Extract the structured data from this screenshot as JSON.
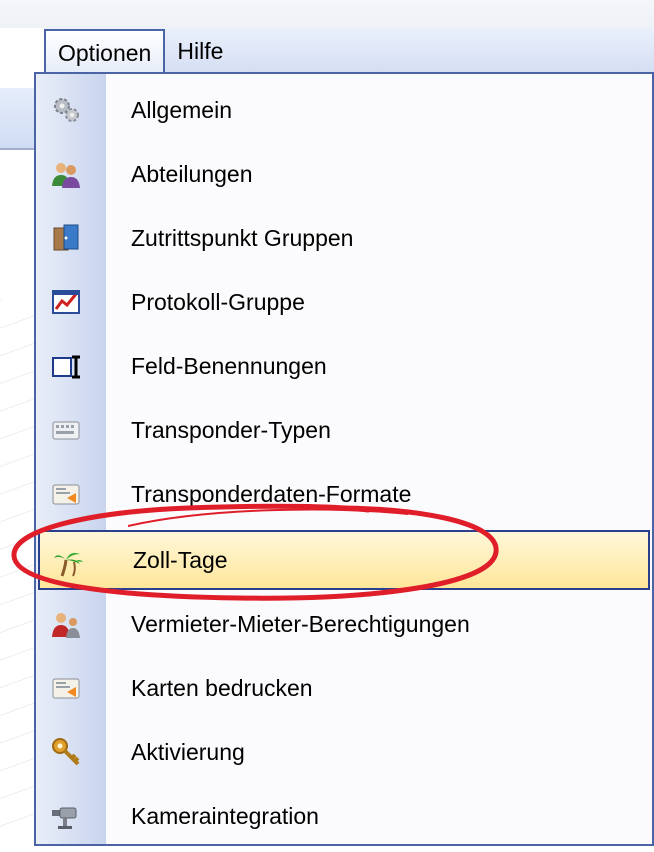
{
  "menubar": {
    "items": [
      {
        "label": "Optionen",
        "active": true
      },
      {
        "label": "Hilfe",
        "active": false
      }
    ]
  },
  "menu": {
    "items": [
      {
        "label": "Allgemein",
        "icon": "gears-icon"
      },
      {
        "label": "Abteilungen",
        "icon": "people-icon"
      },
      {
        "label": "Zutrittspunkt Gruppen",
        "icon": "doors-icon"
      },
      {
        "label": "Protokoll-Gruppe",
        "icon": "report-chart-icon"
      },
      {
        "label": "Feld-Benennungen",
        "icon": "text-field-icon"
      },
      {
        "label": "Transponder-Typen",
        "icon": "keyboard-icon"
      },
      {
        "label": "Transponderdaten-Formate",
        "icon": "card-format-icon"
      },
      {
        "label": "Zoll-Tage",
        "icon": "palm-tree-icon"
      },
      {
        "label": "Vermieter-Mieter-Berechtigungen",
        "icon": "landlord-tenant-icon"
      },
      {
        "label": "Karten bedrucken",
        "icon": "card-print-icon"
      },
      {
        "label": "Aktivierung",
        "icon": "key-icon"
      },
      {
        "label": "Kameraintegration",
        "icon": "camera-icon"
      }
    ],
    "highlighted_index": 7
  },
  "colors": {
    "highlight_border": "#2b3f8f",
    "highlight_fill": "#ffe69a",
    "annotation": "#e01e2a"
  }
}
